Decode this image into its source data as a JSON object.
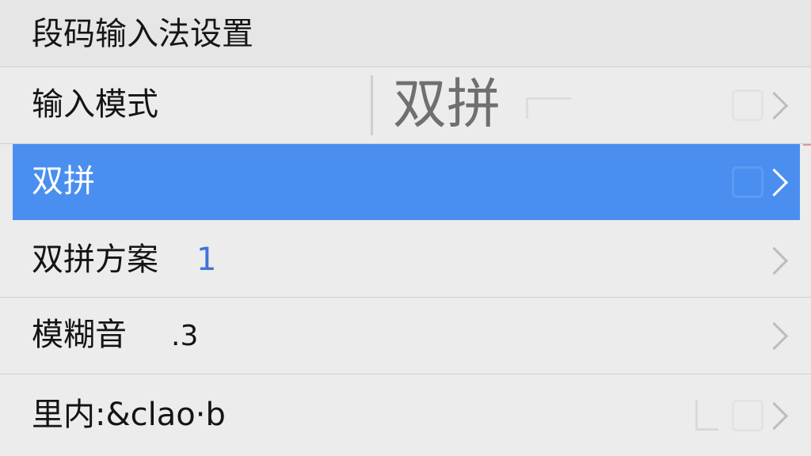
{
  "title": "段码输入法设置",
  "rows": {
    "mode": {
      "label": "输入模式",
      "value": "双拼"
    },
    "selected": {
      "label": "双拼"
    },
    "scheme": {
      "label": "双拼方案",
      "value": "1"
    },
    "fuzzy": {
      "label": "模糊音",
      "value": ".3"
    },
    "other": {
      "label": "里内:&clao·b"
    }
  },
  "colors": {
    "selected_background": "#4a8ff0",
    "accent_number": "#3f74d8",
    "chevron": "#bdbdbd"
  },
  "icons": {
    "row_arrow": "chevron-right-icon"
  }
}
